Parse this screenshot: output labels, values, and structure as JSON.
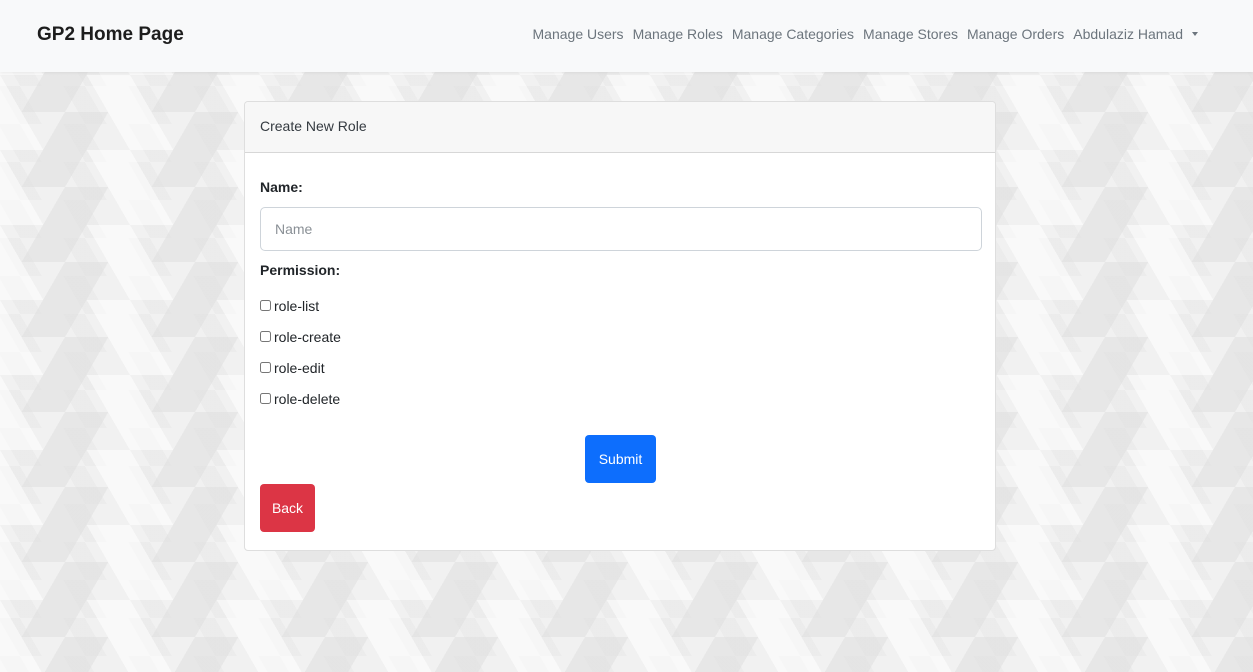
{
  "navbar": {
    "brand": "GP2 Home Page",
    "links": [
      {
        "label": "Manage Users"
      },
      {
        "label": "Manage Roles"
      },
      {
        "label": "Manage Categories"
      },
      {
        "label": "Manage Stores"
      },
      {
        "label": "Manage Orders"
      }
    ],
    "user": "Abdulaziz Hamad"
  },
  "card": {
    "header": "Create New Role",
    "name_label": "Name:",
    "name_placeholder": "Name",
    "name_value": "",
    "permission_label": "Permission:",
    "permissions": [
      {
        "label": "role-list",
        "checked": false
      },
      {
        "label": "role-create",
        "checked": false
      },
      {
        "label": "role-edit",
        "checked": false
      },
      {
        "label": "role-delete",
        "checked": false
      }
    ],
    "submit_label": "Submit",
    "back_label": "Back"
  },
  "colors": {
    "primary": "#0d6efd",
    "danger": "#dc3545",
    "navbar_bg": "#f8f9fa"
  }
}
